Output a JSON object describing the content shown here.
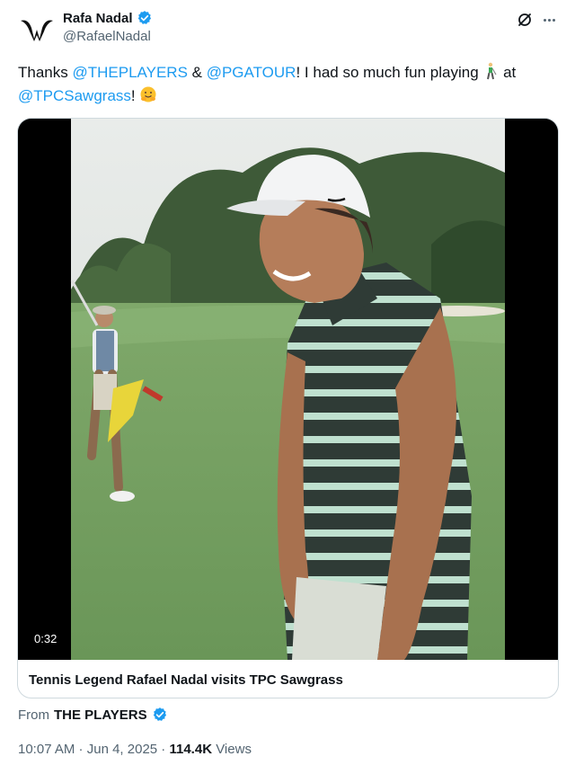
{
  "author": {
    "display_name": "Rafa Nadal",
    "handle": "@RafaelNadal"
  },
  "tweet": {
    "text_1": "Thanks ",
    "mention_1": "@THEPLAYERS",
    "text_2": " & ",
    "mention_2": "@PGATOUR",
    "text_3": "! I had so much fun playing ",
    "text_4": " at ",
    "mention_3": "@TPCSawgrass",
    "text_5": "! "
  },
  "media": {
    "duration": "0:32",
    "card_title": "Tennis Legend Rafael Nadal visits TPC Sawgrass"
  },
  "source": {
    "from_label": "From",
    "name": "THE PLAYERS"
  },
  "meta": {
    "time": "10:07 AM",
    "separator": " · ",
    "date": "Jun 4, 2025",
    "views_count": "114.4K",
    "views_label": " Views"
  },
  "colors": {
    "link": "#1d9bf0",
    "verified": "#1d9bf0",
    "secondary_text": "#536471"
  },
  "icons": [
    "rafa-logo-icon",
    "verified-badge-icon",
    "grok-icon",
    "more-icon",
    "golfer-emoji-icon",
    "hug-emoji-icon"
  ]
}
